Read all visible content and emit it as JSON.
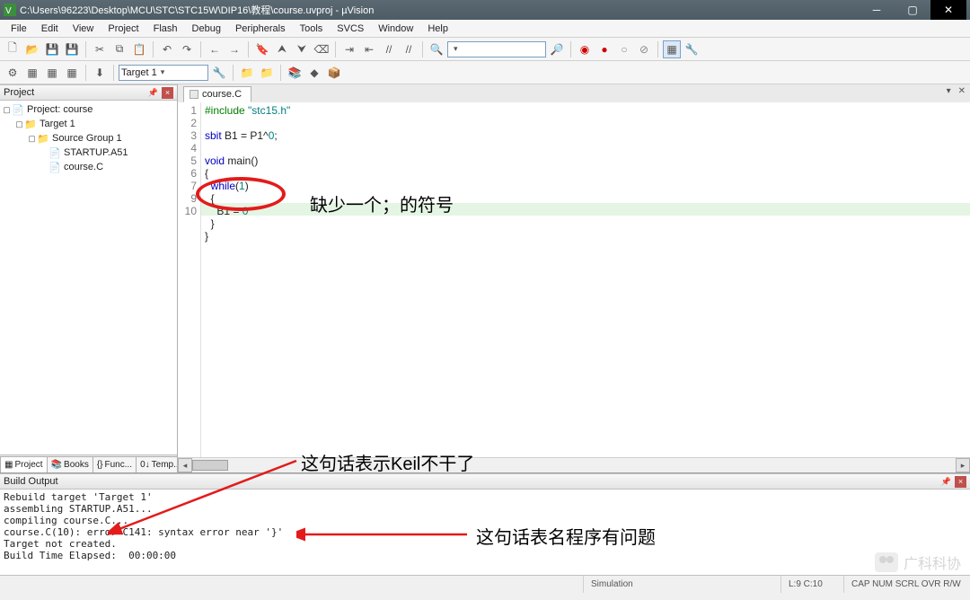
{
  "window": {
    "title": "C:\\Users\\96223\\Desktop\\MCU\\STC\\STC15W\\DIP16\\教程\\course.uvproj - µVision"
  },
  "menu": [
    "File",
    "Edit",
    "View",
    "Project",
    "Flash",
    "Debug",
    "Peripherals",
    "Tools",
    "SVCS",
    "Window",
    "Help"
  ],
  "toolbar2": {
    "target_combo": "Target 1"
  },
  "project_panel": {
    "title": "Project",
    "tree": {
      "root": "Project: course",
      "target": "Target 1",
      "group": "Source Group 1",
      "files": [
        "STARTUP.A51",
        "course.C"
      ]
    },
    "tabs": [
      "Project",
      "Books",
      "Func...",
      "Temp..."
    ]
  },
  "editor": {
    "tab": "course.C",
    "gutter": [
      "1",
      "2",
      "3",
      "4",
      "5",
      "6",
      "7",
      "",
      "9",
      "10",
      ""
    ],
    "lines": [
      {
        "html": "<span class='pp'>#include</span> <span class='str'>\"stc15.h\"</span>"
      },
      {
        "html": ""
      },
      {
        "html": "<span class='kw'>sbit</span> B1 = P1^<span class='num'>0</span>;"
      },
      {
        "html": ""
      },
      {
        "html": "<span class='kw'>void</span> main()"
      },
      {
        "html": "{"
      },
      {
        "html": "  <span class='kw'>while</span>(<span class='num'>1</span>)"
      },
      {
        "html": "  {"
      },
      {
        "html": "    B1 = <span class='num'>0</span>",
        "hl": true
      },
      {
        "html": "  }"
      },
      {
        "html": "}"
      }
    ]
  },
  "build": {
    "title": "Build Output",
    "lines": [
      "Rebuild target 'Target 1'",
      "assembling STARTUP.A51...",
      "compiling course.C...",
      "course.C(10): error C141: syntax error near '}'",
      "Target not created.",
      "Build Time Elapsed:  00:00:00"
    ]
  },
  "status": {
    "sim": "Simulation",
    "pos": "L:9 C:10",
    "caps": "CAP NUM SCRL OVR R/W"
  },
  "annotations": {
    "a1": "缺少一个；的符号",
    "a2": "这句话表示Keil不干了",
    "a3": "这句话表名程序有问题"
  },
  "watermark": "广科科协"
}
